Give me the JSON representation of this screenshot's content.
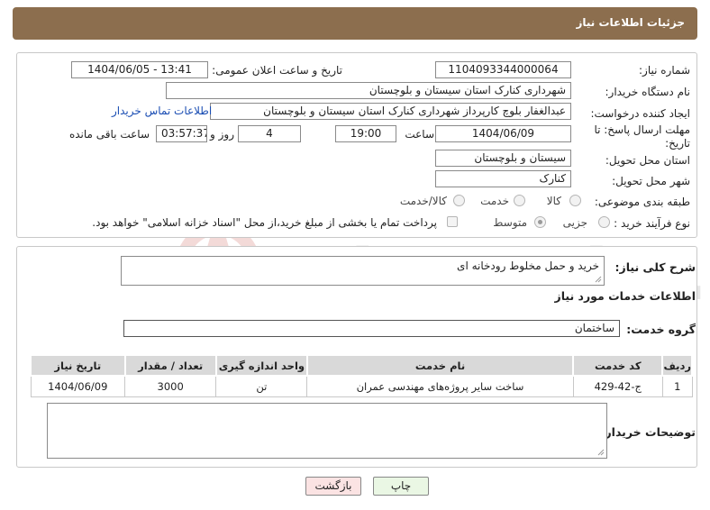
{
  "header": {
    "title": "جزئیات اطلاعات نیاز"
  },
  "form": {
    "need_number_label": "شماره نیاز:",
    "need_number": "1104093344000064",
    "announce_label": "تاریخ و ساعت اعلان عمومی:",
    "announce_value": "1404/06/05 - 13:41",
    "buyer_org_label": "نام دستگاه خریدار:",
    "buyer_org": "شهرداری کنارک استان سیستان و بلوچستان",
    "creator_label": "ایجاد کننده درخواست:",
    "creator": "عبدالغفار بلوچ کارپرداز شهرداری کنارک استان سیستان و بلوچستان",
    "contact_link": "اطلاعات تماس خریدار",
    "deadline_label": "مهلت ارسال پاسخ: تا تاریخ:",
    "deadline_date": "1404/06/09",
    "time_label": "ساعت",
    "deadline_time": "19:00",
    "days_value": "4",
    "days_label": "روز و",
    "remaining_value": "03:57:37",
    "remaining_label": "ساعت باقی مانده",
    "province_label": "استان محل تحویل:",
    "province": "سیستان و بلوچستان",
    "city_label": "شهر محل تحویل:",
    "city": "کنارک",
    "category_label": "طبقه بندی موضوعی:",
    "category_options": [
      "کالا",
      "خدمت",
      "کالا/خدمت"
    ],
    "process_label": "نوع فرآیند خرید :",
    "process_options": [
      "جزیی",
      "متوسط"
    ],
    "payment_note": "پرداخت تمام یا بخشی از مبلغ خرید،از محل \"اسناد خزانه اسلامی\" خواهد بود."
  },
  "summary": {
    "label": "شرح کلی نیاز:",
    "text": "خرید و حمل مخلوط رودخانه ای"
  },
  "services": {
    "section_title": "اطلاعات خدمات مورد نیاز",
    "group_label": "گروه خدمت:",
    "group_value": "ساختمان",
    "columns": [
      "ردیف",
      "کد خدمت",
      "نام خدمت",
      "واحد اندازه گیری",
      "تعداد / مقدار",
      "تاریخ نیاز"
    ],
    "rows": [
      [
        "1",
        "ج-42-429",
        "ساخت سایر پروژه‌های مهندسی عمران",
        "تن",
        "3000",
        "1404/06/09"
      ]
    ]
  },
  "buyer_notes": {
    "label": "توضیحات خریدار:",
    "text": ""
  },
  "buttons": {
    "print": "چاپ",
    "back": "بازگشت"
  },
  "watermark": {
    "text": "AriaTender.neT"
  },
  "colors": {
    "header": "#8c6e4e",
    "link": "#1a4db3",
    "print_btn": "#eaf7e4",
    "back_btn": "#fbe3e3"
  }
}
